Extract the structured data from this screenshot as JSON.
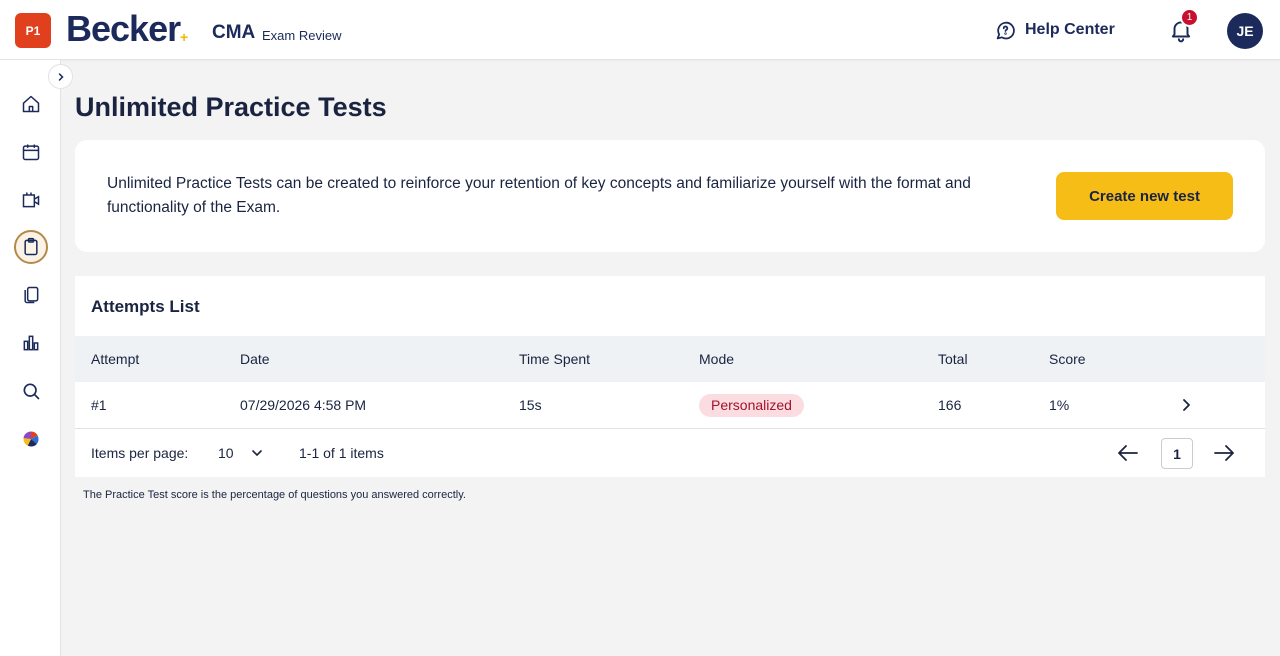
{
  "header": {
    "part_badge": "P1",
    "logo": "Becker",
    "product": "CMA",
    "product_sub": "Exam Review",
    "help_label": "Help Center",
    "notification_count": "1",
    "avatar_initials": "JE"
  },
  "sidebar": {
    "items": [
      {
        "icon": "home-icon"
      },
      {
        "icon": "calendar-icon"
      },
      {
        "icon": "video-icon"
      },
      {
        "icon": "clipboard-icon",
        "active": true
      },
      {
        "icon": "flashcards-icon"
      },
      {
        "icon": "bar-chart-icon"
      },
      {
        "icon": "search-icon"
      },
      {
        "icon": "puzzle-icon"
      }
    ]
  },
  "page": {
    "title": "Unlimited Practice Tests",
    "intro": "Unlimited Practice Tests can be created to reinforce your retention of key concepts and familiarize yourself with the format and functionality of the Exam.",
    "create_button": "Create new test"
  },
  "attempts": {
    "title": "Attempts List",
    "columns": [
      "Attempt",
      "Date",
      "Time Spent",
      "Mode",
      "Total",
      "Score"
    ],
    "rows": [
      {
        "attempt": "#1",
        "date": "07/29/2026 4:58 PM",
        "time_spent": "15s",
        "mode": "Personalized",
        "total": "166",
        "score": "1%"
      }
    ],
    "items_per_page_label": "Items per page:",
    "items_per_page": "10",
    "range": "1-1 of 1 items",
    "current_page": "1"
  },
  "footnote": "The Practice Test score is the percentage of questions you answered correctly.",
  "colors": {
    "brand_navy": "#1b2a5a",
    "accent_yellow": "#f6bd17",
    "badge_red": "#c8102e",
    "part_badge": "#e0401d",
    "mode_pill_bg": "#fbdde1",
    "mode_pill_text": "#a3122a"
  }
}
